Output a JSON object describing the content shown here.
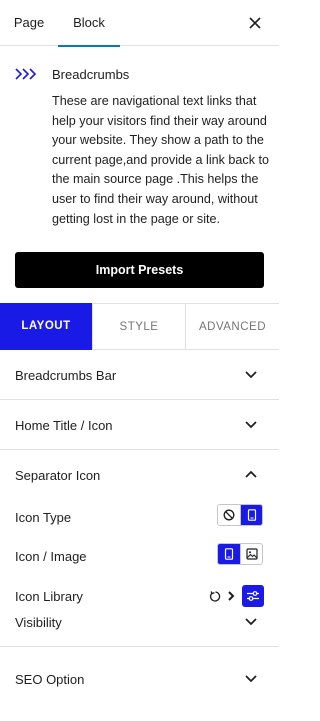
{
  "header": {
    "tabs": [
      "Page",
      "Block"
    ],
    "active_tab": "Block"
  },
  "block": {
    "name": "Breadcrumbs",
    "description": "These are navigational text links that help your visitors find their way around your website. They show a path to the current page,and provide a link back to the main source page .This helps the user to find their way around, without getting lost in the page or site."
  },
  "import_button": "Import Presets",
  "panel_tabs": [
    "LAYOUT",
    "STYLE",
    "ADVANCED"
  ],
  "active_panel_tab": "LAYOUT",
  "sections": [
    {
      "title": "Breadcrumbs Bar",
      "expanded": false
    },
    {
      "title": "Home Title / Icon",
      "expanded": false
    },
    {
      "title": "Separator Icon",
      "expanded": true
    },
    {
      "title": "Visibility",
      "expanded": false
    },
    {
      "title": "SEO Option",
      "expanded": false
    }
  ],
  "separator": {
    "icon_type_label": "Icon Type",
    "icon_image_label": "Icon / Image",
    "icon_library_label": "Icon Library"
  },
  "colors": {
    "accent": "#1a1ae6",
    "tab_underline": "#007cba",
    "button_bg": "#000000"
  },
  "icons": {
    "block_icon": "double-chevron-right-icon",
    "close": "close-icon",
    "none": "ban-icon",
    "icon_mode": "device-icon",
    "image_mode": "image-icon",
    "reset": "reset-icon",
    "library": "sliders-icon"
  }
}
